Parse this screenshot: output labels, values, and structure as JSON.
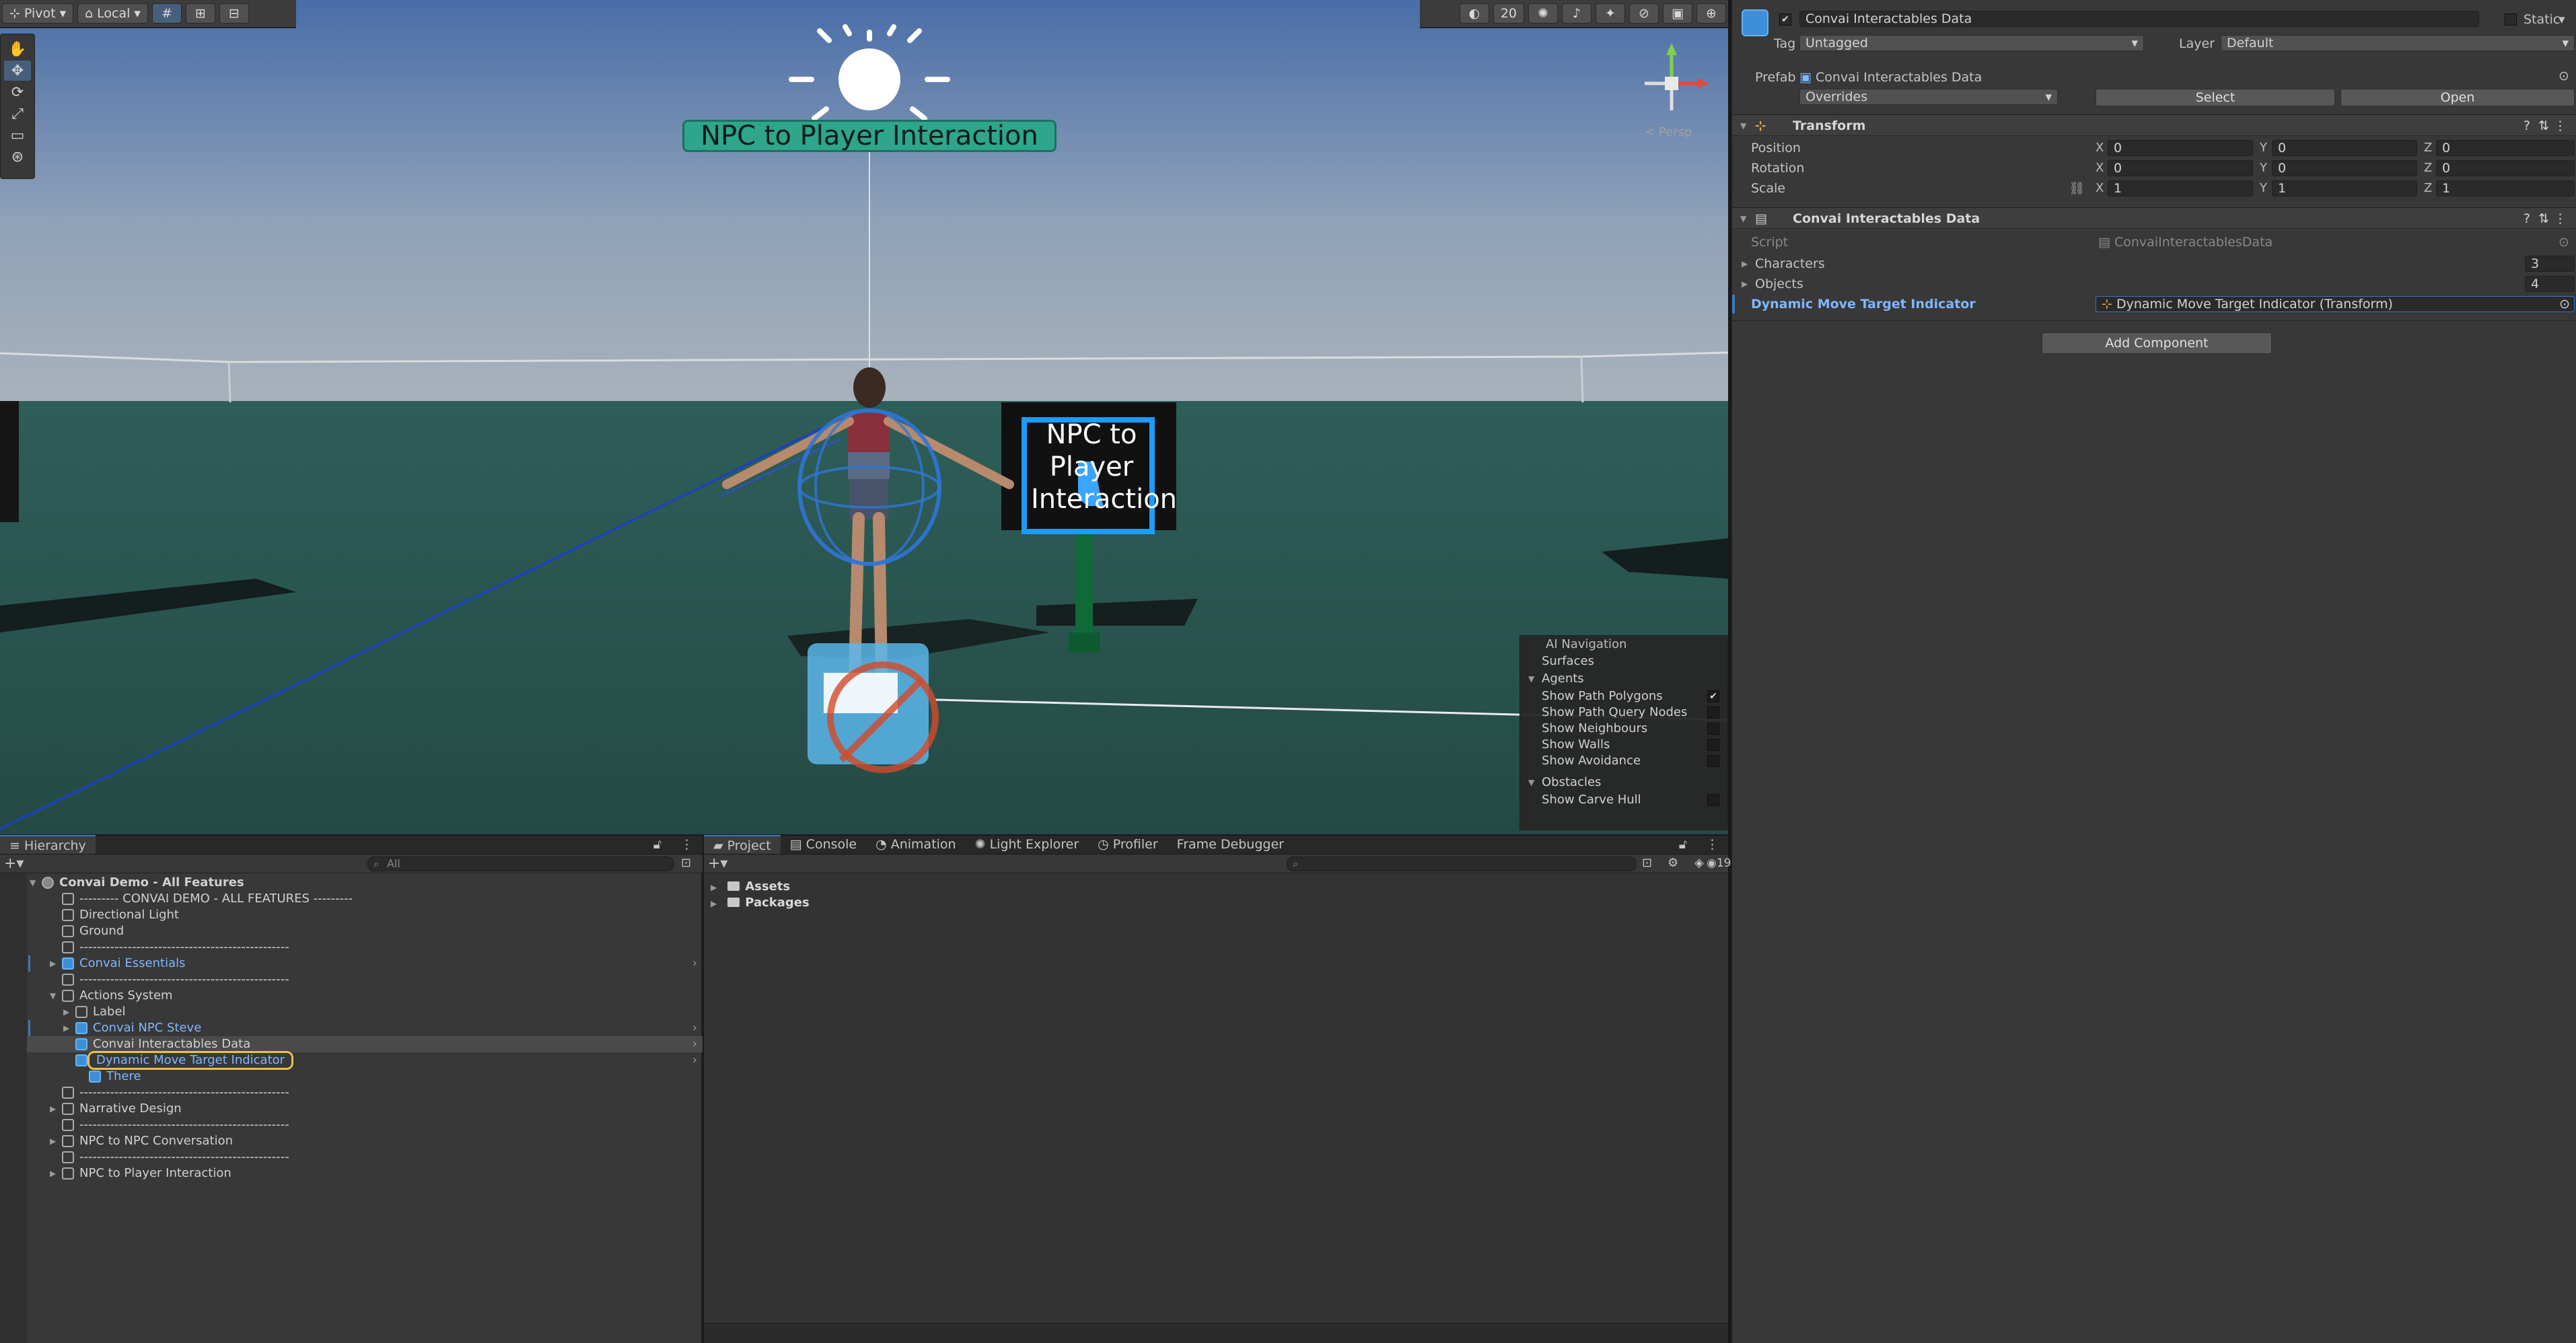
{
  "scene_toolbar": {
    "pivot": "Pivot",
    "local": "Local",
    "gizmo_count": "20"
  },
  "scene": {
    "world_label": "NPC to Player Interaction",
    "sign_text_lines": [
      "NPC to",
      "Player",
      "Interaction"
    ],
    "persp_label": "< Persp"
  },
  "ai_navigation": {
    "title": "AI Navigation",
    "surfaces": "Surfaces",
    "agents": "Agents",
    "agent_options": [
      {
        "label": "Show Path Polygons",
        "checked": true
      },
      {
        "label": "Show Path Query Nodes",
        "checked": false
      },
      {
        "label": "Show Neighbours",
        "checked": false
      },
      {
        "label": "Show Walls",
        "checked": false
      },
      {
        "label": "Show Avoidance",
        "checked": false
      }
    ],
    "obstacles": "Obstacles",
    "obstacle_options": [
      {
        "label": "Show Carve Hull",
        "checked": false
      }
    ]
  },
  "inspector": {
    "object_name": "Convai Interactables Data",
    "static_label": "Static",
    "tag_label": "Tag",
    "tag_value": "Untagged",
    "layer_label": "Layer",
    "layer_value": "Default",
    "prefab_label": "Prefab",
    "prefab_value": "Convai Interactables Data",
    "overrides_label": "Overrides",
    "select_label": "Select",
    "open_label": "Open",
    "transform": {
      "title": "Transform",
      "position_label": "Position",
      "rotation_label": "Rotation",
      "scale_label": "Scale",
      "x_label": "X",
      "y_label": "Y",
      "z_label": "Z",
      "position": {
        "x": "0",
        "y": "0",
        "z": "0"
      },
      "rotation": {
        "x": "0",
        "y": "0",
        "z": "0"
      },
      "scale": {
        "x": "1",
        "y": "1",
        "z": "1"
      }
    },
    "component": {
      "title": "Convai Interactables Data",
      "script_label": "Script",
      "script_value": "ConvaiInteractablesData",
      "characters_label": "Characters",
      "characters_value": "3",
      "objects_label": "Objects",
      "objects_value": "4",
      "dmti_label": "Dynamic Move Target Indicator",
      "dmti_value": "Dynamic Move Target Indicator (Transform)"
    },
    "add_component": "Add Component"
  },
  "hierarchy": {
    "tab": "Hierarchy",
    "search_placeholder": "All",
    "rows": [
      {
        "text": "Convai Demo - All Features",
        "indent": 0,
        "arrow": "down",
        "scene": true,
        "bold": true
      },
      {
        "text": "--------- CONVAI DEMO - ALL FEATURES ---------",
        "indent": 1
      },
      {
        "text": "Directional Light",
        "indent": 1
      },
      {
        "text": "Ground",
        "indent": 1
      },
      {
        "text": "------------------------------------------------",
        "indent": 1
      },
      {
        "text": "Convai Essentials",
        "indent": 1,
        "arrow": "right",
        "blue": true,
        "chevron": true
      },
      {
        "text": "------------------------------------------------",
        "indent": 1
      },
      {
        "text": "Actions System",
        "indent": 1,
        "arrow": "down"
      },
      {
        "text": "Label",
        "indent": 2,
        "arrow": "right"
      },
      {
        "text": "Convai NPC Steve",
        "indent": 2,
        "arrow": "right",
        "blue": true,
        "chevron": true
      },
      {
        "text": "Convai Interactables Data",
        "indent": 2,
        "prefab": true,
        "selected": true,
        "chevron": true
      },
      {
        "text": "Dynamic Move Target Indicator",
        "indent": 2,
        "prefab": true,
        "blue": true,
        "highlight": true,
        "chevron": true
      },
      {
        "text": "There",
        "indent": 3,
        "blue": true
      },
      {
        "text": "------------------------------------------------",
        "indent": 1
      },
      {
        "text": "Narrative Design",
        "indent": 1,
        "arrow": "right"
      },
      {
        "text": "------------------------------------------------",
        "indent": 1
      },
      {
        "text": "NPC to NPC Conversation",
        "indent": 1,
        "arrow": "right"
      },
      {
        "text": "------------------------------------------------",
        "indent": 1
      },
      {
        "text": "NPC to Player Interaction",
        "indent": 1,
        "arrow": "right"
      }
    ]
  },
  "project": {
    "tabs": [
      "Project",
      "Console",
      "Animation",
      "Light Explorer",
      "Profiler",
      "Frame Debugger"
    ],
    "folders": [
      "Assets",
      "Packages"
    ],
    "count": "19"
  }
}
